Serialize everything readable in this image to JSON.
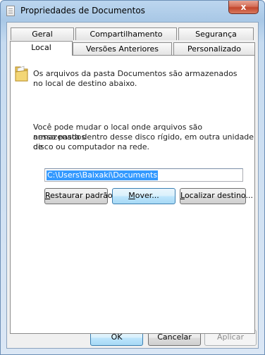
{
  "window": {
    "title": "Propriedades de Documentos",
    "close_label": "x"
  },
  "tabs": {
    "row1": [
      {
        "label": "Geral"
      },
      {
        "label": "Compartilhamento"
      },
      {
        "label": "Segurança"
      }
    ],
    "row2": [
      {
        "label": "Local",
        "selected": true
      },
      {
        "label": "Versões Anteriores"
      },
      {
        "label": "Personalizado"
      }
    ]
  },
  "local": {
    "description_line1": "Os arquivos da pasta Documentos são armazenados",
    "description_line2": "no local de destino abaixo.",
    "info_line1": "Você pode mudar o local onde arquivos são armazenados",
    "info_line2": "nessa pasta dentro desse disco rígido, em outra unidade de",
    "info_line3": "disco ou computador na rede.",
    "path_value": "C:\\Users\\Baixaki\\Documents",
    "buttons": {
      "restore_first": "R",
      "restore_rest": "estaurar padrão",
      "move_first": "M",
      "move_rest": "over...",
      "find_first": "L",
      "find_rest": "ocalizar destino..."
    }
  },
  "footer": {
    "ok": "OK",
    "cancel": "Cancelar",
    "apply": "Aplicar"
  },
  "colors": {
    "selection": "#3399ff",
    "frame": "#a9c8e6",
    "close_button": "#c3462c"
  },
  "icons": [
    "document-icon",
    "close-icon",
    "folder-icon"
  ]
}
